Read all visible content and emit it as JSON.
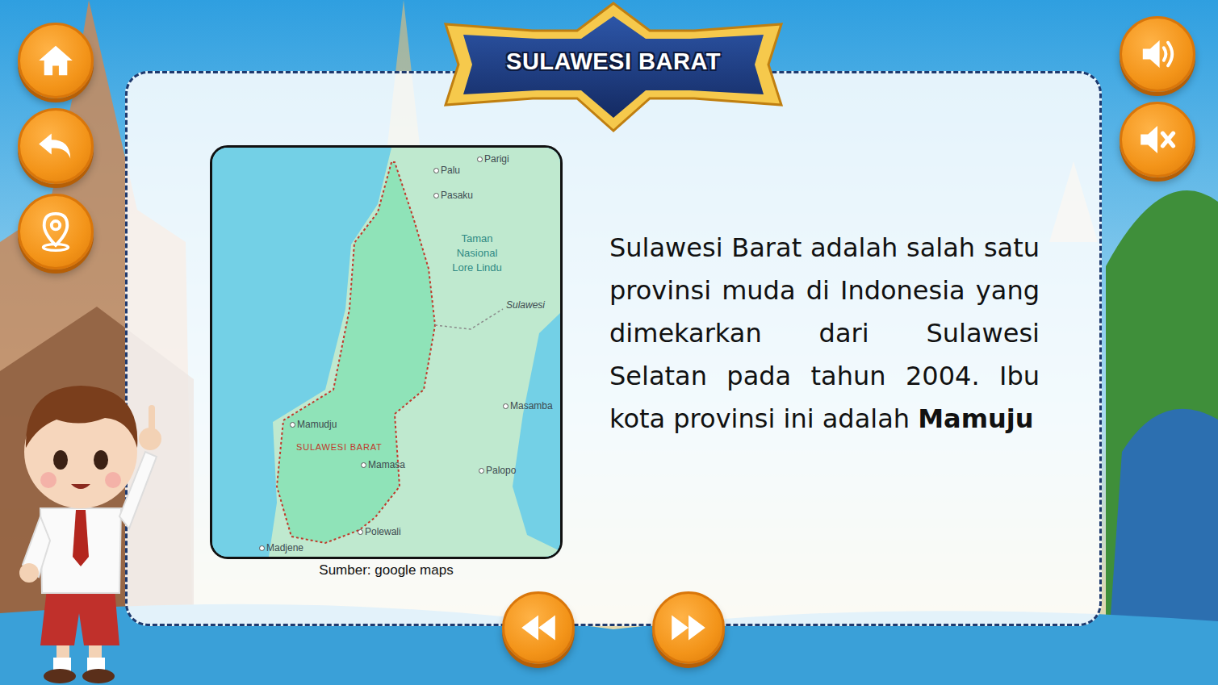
{
  "title": "SULAWESI BARAT",
  "map": {
    "places": [
      {
        "name": "Parigi",
        "kind": "city"
      },
      {
        "name": "Palu",
        "kind": "city"
      },
      {
        "name": "Pasaku",
        "kind": "city"
      },
      {
        "name": "Taman Nasional Lore Lindu",
        "kind": "park"
      },
      {
        "name": "Sulawesi",
        "kind": "region"
      },
      {
        "name": "Masamba",
        "kind": "city"
      },
      {
        "name": "Mamudju",
        "kind": "city"
      },
      {
        "name": "SULAWESI BARAT",
        "kind": "province"
      },
      {
        "name": "Mamasa",
        "kind": "city"
      },
      {
        "name": "Palopo",
        "kind": "city"
      },
      {
        "name": "Polewali",
        "kind": "city"
      },
      {
        "name": "Madjene",
        "kind": "city"
      }
    ],
    "source": "Sumber: google maps"
  },
  "paragraph": [
    {
      "text": "Sulawesi Barat adalah salah satu provinsi muda di Indonesia yang dimekarkan dari Sulawesi Selatan pada tahun 2004. Ibu kota provinsi ini adalah ",
      "bold": false
    },
    {
      "text": "Mamuju",
      "bold": true
    }
  ]
}
